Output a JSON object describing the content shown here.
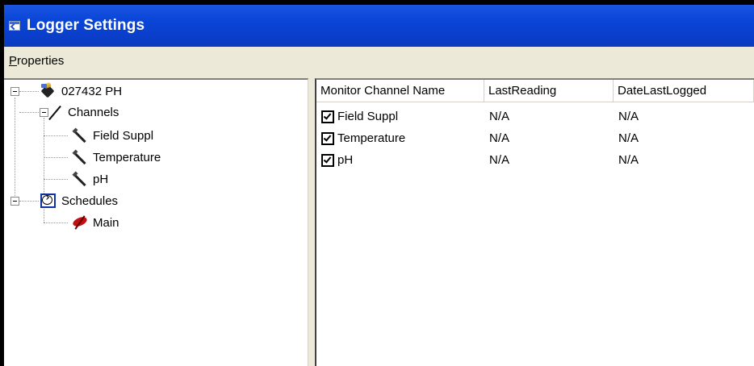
{
  "window": {
    "title": "Logger Settings",
    "title_icon": "window-arrow-icon",
    "accent_color": "#0a46d8"
  },
  "menu": {
    "items": [
      {
        "mnemonic": "P",
        "rest": "roperties"
      }
    ]
  },
  "tree": {
    "root": {
      "label": "027432 PH",
      "icon": "logger-icon",
      "expanded": true
    },
    "channels": {
      "label": "Channels",
      "icon": "pen-icon",
      "expanded": true,
      "children": [
        {
          "label": "Field Suppl",
          "icon": "probe-icon"
        },
        {
          "label": "Temperature",
          "icon": "probe-icon"
        },
        {
          "label": "pH",
          "icon": "probe-icon"
        }
      ]
    },
    "schedules": {
      "label": "Schedules",
      "icon": "clock-icon",
      "expanded": true,
      "children": [
        {
          "label": "Main",
          "icon": "schedule-main-icon"
        }
      ]
    }
  },
  "list": {
    "columns": [
      "Monitor Channel Name",
      "LastReading",
      "DateLastLogged"
    ],
    "rows": [
      {
        "checked": true,
        "name": "Field Suppl",
        "last_reading": "N/A",
        "date_last_logged": "N/A"
      },
      {
        "checked": true,
        "name": "Temperature",
        "last_reading": "N/A",
        "date_last_logged": "N/A"
      },
      {
        "checked": true,
        "name": "pH",
        "last_reading": "N/A",
        "date_last_logged": "N/A"
      }
    ]
  }
}
